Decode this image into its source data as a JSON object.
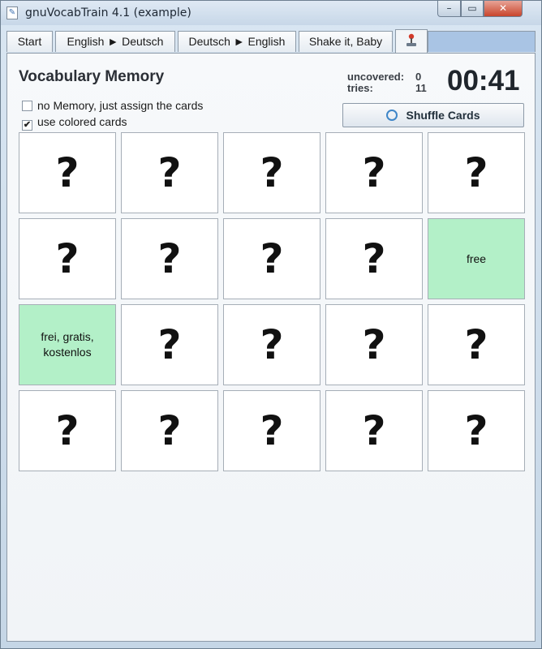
{
  "window": {
    "title": "gnuVocabTrain 4.1 (example)",
    "controls": {
      "minimize": "–",
      "maximize": "▭",
      "close": "✕"
    }
  },
  "tabs": [
    {
      "label": "Start"
    },
    {
      "label": "English ► Deutsch"
    },
    {
      "label": "Deutsch ► English"
    },
    {
      "label": "Shake it, Baby"
    },
    {
      "label": "",
      "icon": "joystick-icon"
    }
  ],
  "memory": {
    "heading": "Vocabulary Memory",
    "options": [
      {
        "label": "no Memory, just assign the cards",
        "checked": false
      },
      {
        "label": "use colored cards",
        "checked": true
      }
    ],
    "stats": {
      "uncovered_label": "uncovered:",
      "uncovered_value": "0",
      "tries_label": "tries:",
      "tries_value": "11"
    },
    "timer": "00:41",
    "shuffle_label": "Shuffle Cards",
    "cards": [
      "?",
      "?",
      "?",
      "?",
      "?",
      "?",
      "?",
      "?",
      "?",
      "free",
      "frei, gratis, kostenlos",
      "?",
      "?",
      "?",
      "?",
      "?",
      "?",
      "?",
      "?",
      "?"
    ]
  },
  "colors": {
    "revealed_card": "#b3f0c8",
    "tab_accent": "#a9c4e4"
  }
}
